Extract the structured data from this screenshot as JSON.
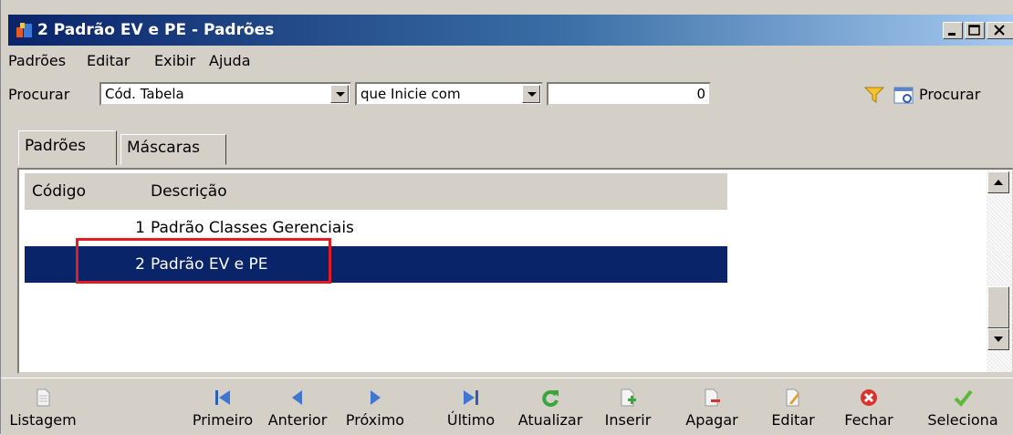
{
  "window": {
    "title": "2 Padrão EV e PE - Padrões"
  },
  "menu": [
    {
      "label": "Padrões"
    },
    {
      "label": "Editar"
    },
    {
      "label": "Exibir"
    },
    {
      "label": "Ajuda"
    }
  ],
  "search": {
    "label": "Procurar",
    "field": "Cód. Tabela",
    "operator": "que Inicie com",
    "value": "0",
    "button": "Procurar"
  },
  "tabs": [
    {
      "label": "Padrões",
      "active": true
    },
    {
      "label": "Máscaras",
      "active": false
    }
  ],
  "table": {
    "columns": [
      "Código",
      "Descrição"
    ],
    "rows": [
      {
        "code": "1",
        "description": "Padrão Classes Gerenciais",
        "selected": false
      },
      {
        "code": "2",
        "description": "Padrão EV e PE",
        "selected": true
      }
    ]
  },
  "toolbar": [
    {
      "label": "Listagem",
      "icon": "document-icon"
    },
    {
      "label": "Primeiro",
      "icon": "first-icon"
    },
    {
      "label": "Anterior",
      "icon": "prev-icon"
    },
    {
      "label": "Próximo",
      "icon": "next-icon"
    },
    {
      "label": "Último",
      "icon": "last-icon"
    },
    {
      "label": "Atualizar",
      "icon": "refresh-icon"
    },
    {
      "label": "Inserir",
      "icon": "insert-icon"
    },
    {
      "label": "Apagar",
      "icon": "delete-icon"
    },
    {
      "label": "Editar",
      "icon": "edit-icon"
    },
    {
      "label": "Fechar",
      "icon": "close-icon"
    },
    {
      "label": "Seleciona",
      "icon": "check-icon"
    }
  ],
  "colors": {
    "titlebar": "#0a246a",
    "selection": "#0a246a",
    "highlight": "#e31b23"
  }
}
